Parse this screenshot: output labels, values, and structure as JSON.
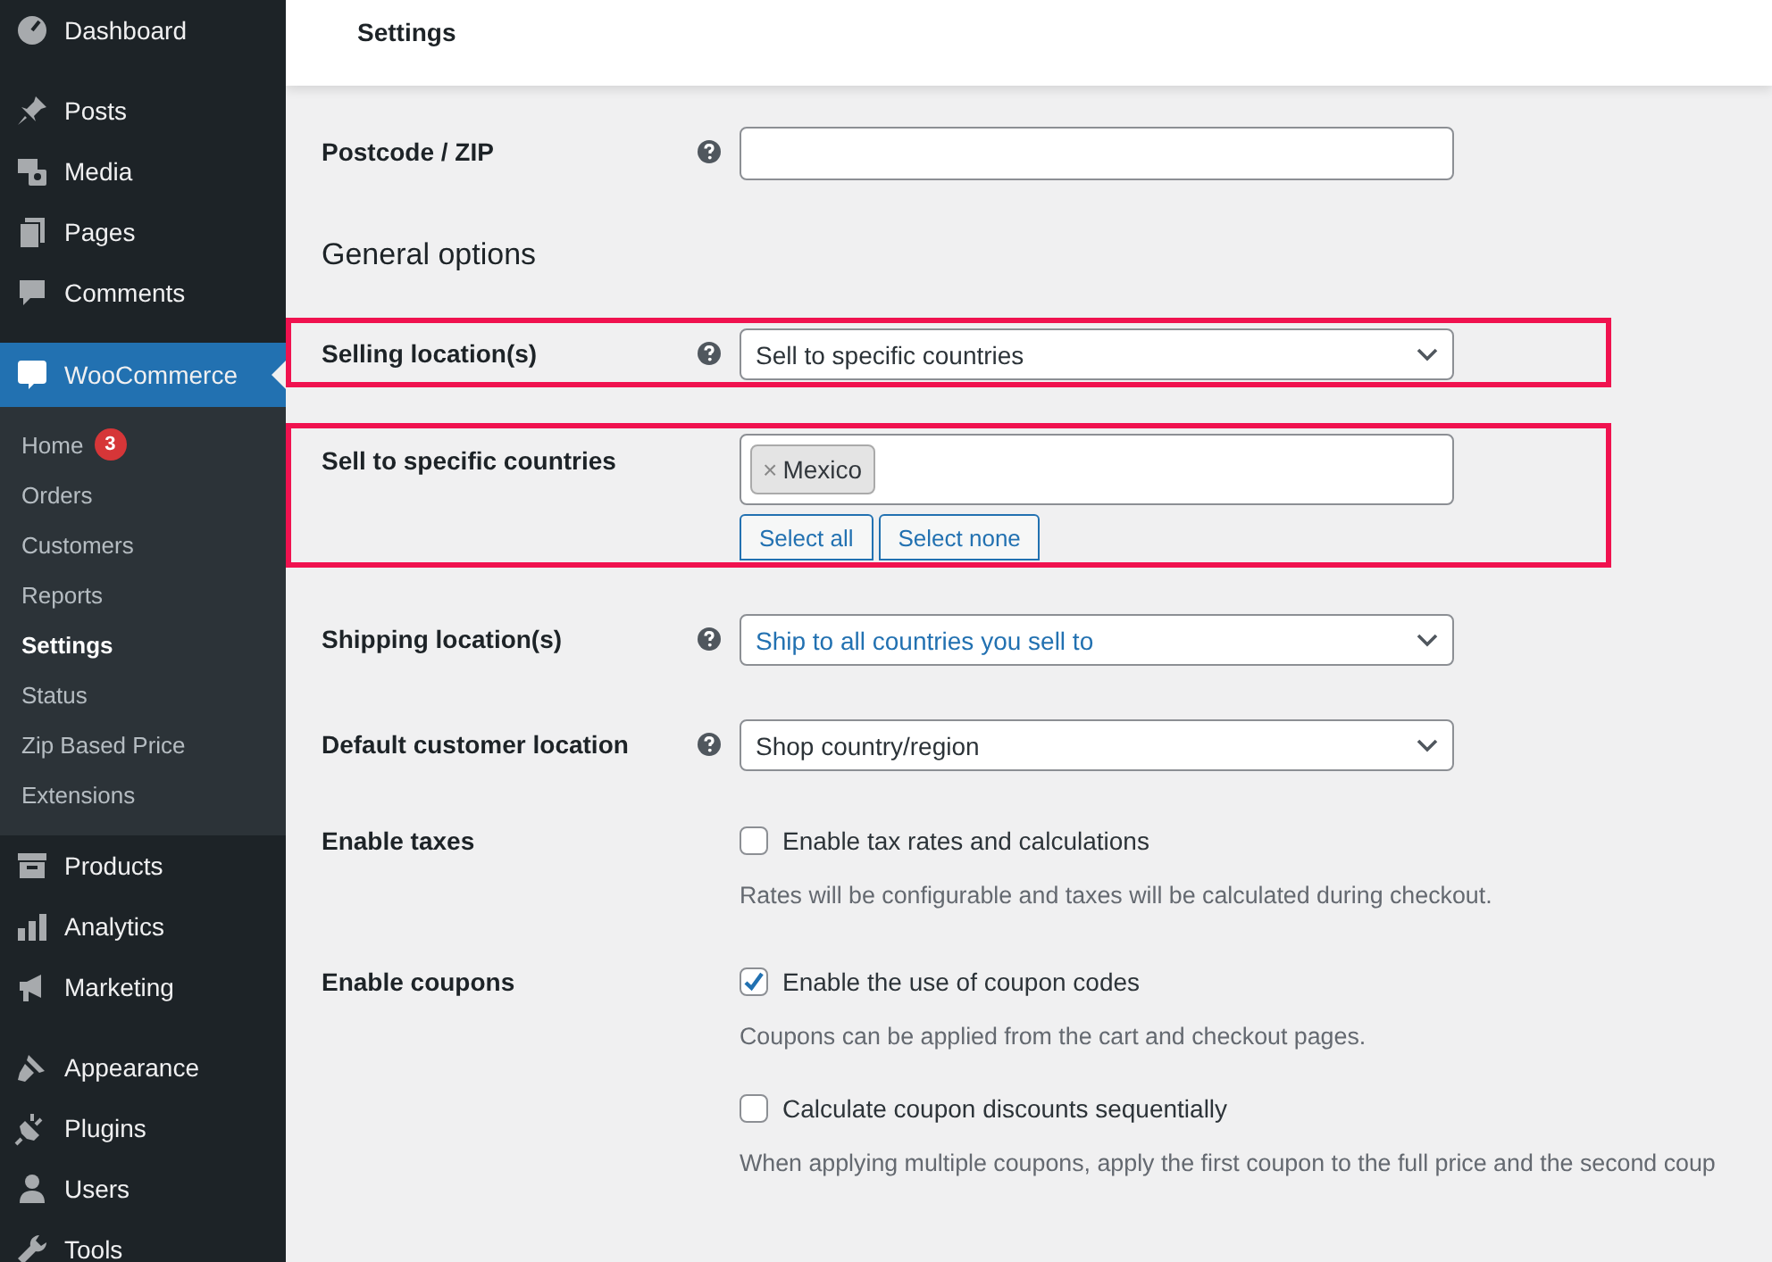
{
  "header": {
    "title": "Settings"
  },
  "sidebar": {
    "groups": [
      [
        {
          "label": "Dashboard",
          "selected": false
        }
      ],
      [
        {
          "label": "Posts",
          "selected": false
        },
        {
          "label": "Media",
          "selected": false
        },
        {
          "label": "Pages",
          "selected": false
        },
        {
          "label": "Comments",
          "selected": false
        }
      ],
      [
        {
          "label": "WooCommerce",
          "selected": true,
          "children": [
            {
              "label": "Home",
              "badge": "3",
              "selected": false
            },
            {
              "label": "Orders",
              "selected": false
            },
            {
              "label": "Customers",
              "selected": false
            },
            {
              "label": "Reports",
              "selected": false
            },
            {
              "label": "Settings",
              "selected": true
            },
            {
              "label": "Status",
              "selected": false
            },
            {
              "label": "Zip Based Price",
              "selected": false
            },
            {
              "label": "Extensions",
              "selected": false
            }
          ]
        },
        {
          "label": "Products",
          "selected": false
        },
        {
          "label": "Analytics",
          "selected": false
        },
        {
          "label": "Marketing",
          "selected": false
        }
      ],
      [
        {
          "label": "Appearance",
          "selected": false
        },
        {
          "label": "Plugins",
          "selected": false
        },
        {
          "label": "Users",
          "selected": false
        },
        {
          "label": "Tools",
          "selected": false
        }
      ]
    ]
  },
  "form": {
    "rows": [
      {
        "kind": "text",
        "label": "Postcode / ZIP",
        "help": true,
        "highlighted": false
      },
      {
        "kind": "heading",
        "label": "General options"
      },
      {
        "kind": "select",
        "label": "Selling location(s)",
        "help": true,
        "value": "Sell to specific countries",
        "focused": false,
        "highlighted": true
      },
      {
        "kind": "multiselect",
        "label": "Sell to specific countries",
        "help": false,
        "tags": [
          {
            "remove": "×",
            "label": "Mexico"
          }
        ],
        "buttons": [
          "Select all",
          "Select none"
        ],
        "highlighted": true
      },
      {
        "kind": "select",
        "label": "Shipping location(s)",
        "help": true,
        "value": "Ship to all countries you sell to",
        "focused": true,
        "highlighted": false
      },
      {
        "kind": "select",
        "label": "Default customer location",
        "help": true,
        "value": "Shop country/region",
        "focused": false,
        "highlighted": false
      },
      {
        "kind": "checkboxes",
        "label": "Enable taxes",
        "help": false,
        "highlighted": false,
        "options": [
          {
            "label": "Enable tax rates and calculations",
            "checked": false,
            "description": "Rates will be configurable and taxes will be calculated during checkout."
          }
        ]
      },
      {
        "kind": "checkboxes",
        "label": "Enable coupons",
        "help": false,
        "highlighted": false,
        "options": [
          {
            "label": "Enable the use of coupon codes",
            "checked": true,
            "description": "Coupons can be applied from the cart and checkout pages."
          },
          {
            "label": "Calculate coupon discounts sequentially",
            "checked": false,
            "description": "When applying multiple coupons, apply the first coupon to the full price and the second coup"
          }
        ]
      }
    ]
  }
}
